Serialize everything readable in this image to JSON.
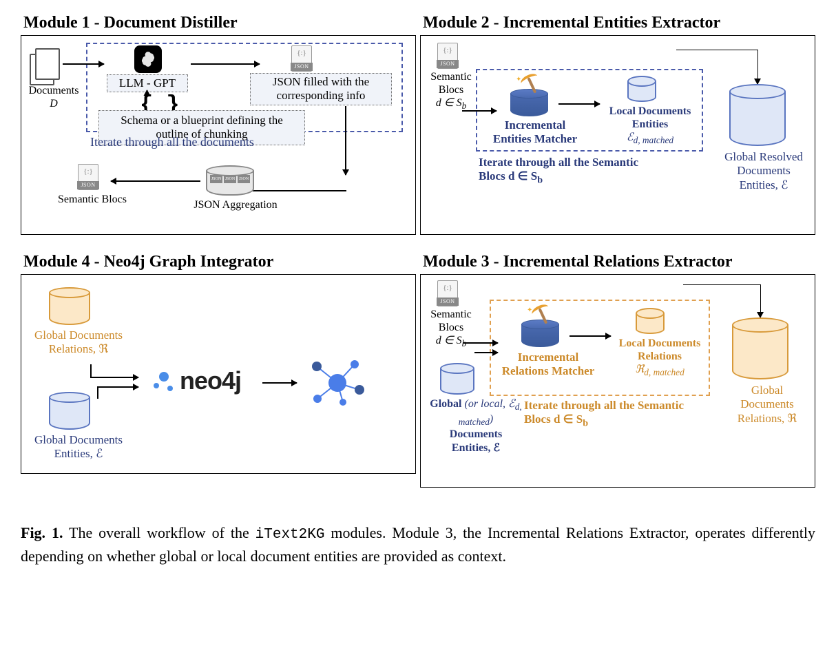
{
  "modules": {
    "m1": {
      "title": "Module 1 - Document Distiller",
      "documents_label": "Documents",
      "documents_var": "D",
      "llm_label": "LLM - GPT",
      "schema_label": "Schema or a blueprint defining the outline of chunking",
      "json_filled_label": "JSON filled with the corresponding info",
      "iterate_label": "Iterate through all the documents",
      "semantic_blocs_label": "Semantic Blocs",
      "json_agg_label": "JSON Aggregation"
    },
    "m2": {
      "title": "Module 2 - Incremental Entities Extractor",
      "semantic_blocs_label": "Semantic Blocs",
      "semantic_blocs_var": "d ∈ S",
      "semantic_blocs_sub": "b",
      "matcher_label_1": "Incremental",
      "matcher_label_2": "Entities Matcher",
      "local_label_1": "Local Documents",
      "local_label_2": "Entities",
      "local_var": "ℰ",
      "local_var_sub": "d, matched",
      "iterate_label_1": "Iterate through all the Semantic",
      "iterate_label_2": "Blocs d ∈  S",
      "iterate_sub": "b",
      "global_label_1": "Global Resolved",
      "global_label_2": "Documents",
      "global_label_3": "Entities, ℰ"
    },
    "m3": {
      "title": "Module 3 - Incremental Relations Extractor",
      "semantic_blocs_label": "Semantic Blocs",
      "semantic_blocs_var": "d ∈ S",
      "semantic_blocs_sub": "b",
      "input_db_1": "Global",
      "input_db_italic": "(or local, ℰ",
      "input_db_italic_sub": "d, matched",
      "input_db_italic_close": ")",
      "input_db_2": "Documents",
      "input_db_3": "Entities, ℰ",
      "matcher_label_1": "Incremental",
      "matcher_label_2": "Relations Matcher",
      "local_label_1": "Local Documents",
      "local_label_2": "Relations",
      "local_var": "ℜ",
      "local_var_sub": "d, matched",
      "iterate_label_1": "Iterate through all the Semantic",
      "iterate_label_2": "Blocs d ∈  S",
      "iterate_sub": "b",
      "global_label_1": "Global",
      "global_label_2": "Documents",
      "global_label_3": "Relations, ℜ"
    },
    "m4": {
      "title": "Module 4 - Neo4j Graph Integrator",
      "relations_label_1": "Global Documents",
      "relations_label_2": "Relations, ℜ",
      "entities_label_1": "Global Documents",
      "entities_label_2": "Entities, ℰ",
      "neo4j_text": "neo4j"
    }
  },
  "caption": {
    "prefix": "Fig. 1.",
    "text_before": " The overall workflow of the ",
    "code": "iText2KG",
    "text_after": " modules. Module 3, the Incremental Relations Extractor, operates differently depending on whether global or local document entities are provided as context."
  }
}
